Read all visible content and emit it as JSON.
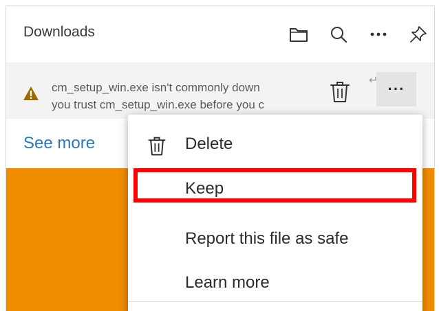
{
  "header": {
    "title": "Downloads",
    "icons": [
      "folder-icon",
      "search-icon",
      "more-icon",
      "pin-icon"
    ]
  },
  "download_item": {
    "line1": "cm_setup_win.exe isn't commonly down",
    "line2": "you trust cm_setup_win.exe before you c",
    "warning_icon": "warning-icon",
    "delete_icon": "trash-icon",
    "arrow_glyph": "↵",
    "more_label": "···"
  },
  "see_more": "See more",
  "context_menu": {
    "items": [
      {
        "label": "Delete",
        "icon": "trash-icon"
      },
      {
        "label": "Keep"
      },
      {
        "label": "Report this file as safe"
      },
      {
        "label": "Learn more"
      }
    ]
  },
  "colors": {
    "accent_link": "#2c79b8",
    "warning": "#9a6a00",
    "highlight_border": "#ff0000",
    "background_orange": "#f08c00"
  }
}
